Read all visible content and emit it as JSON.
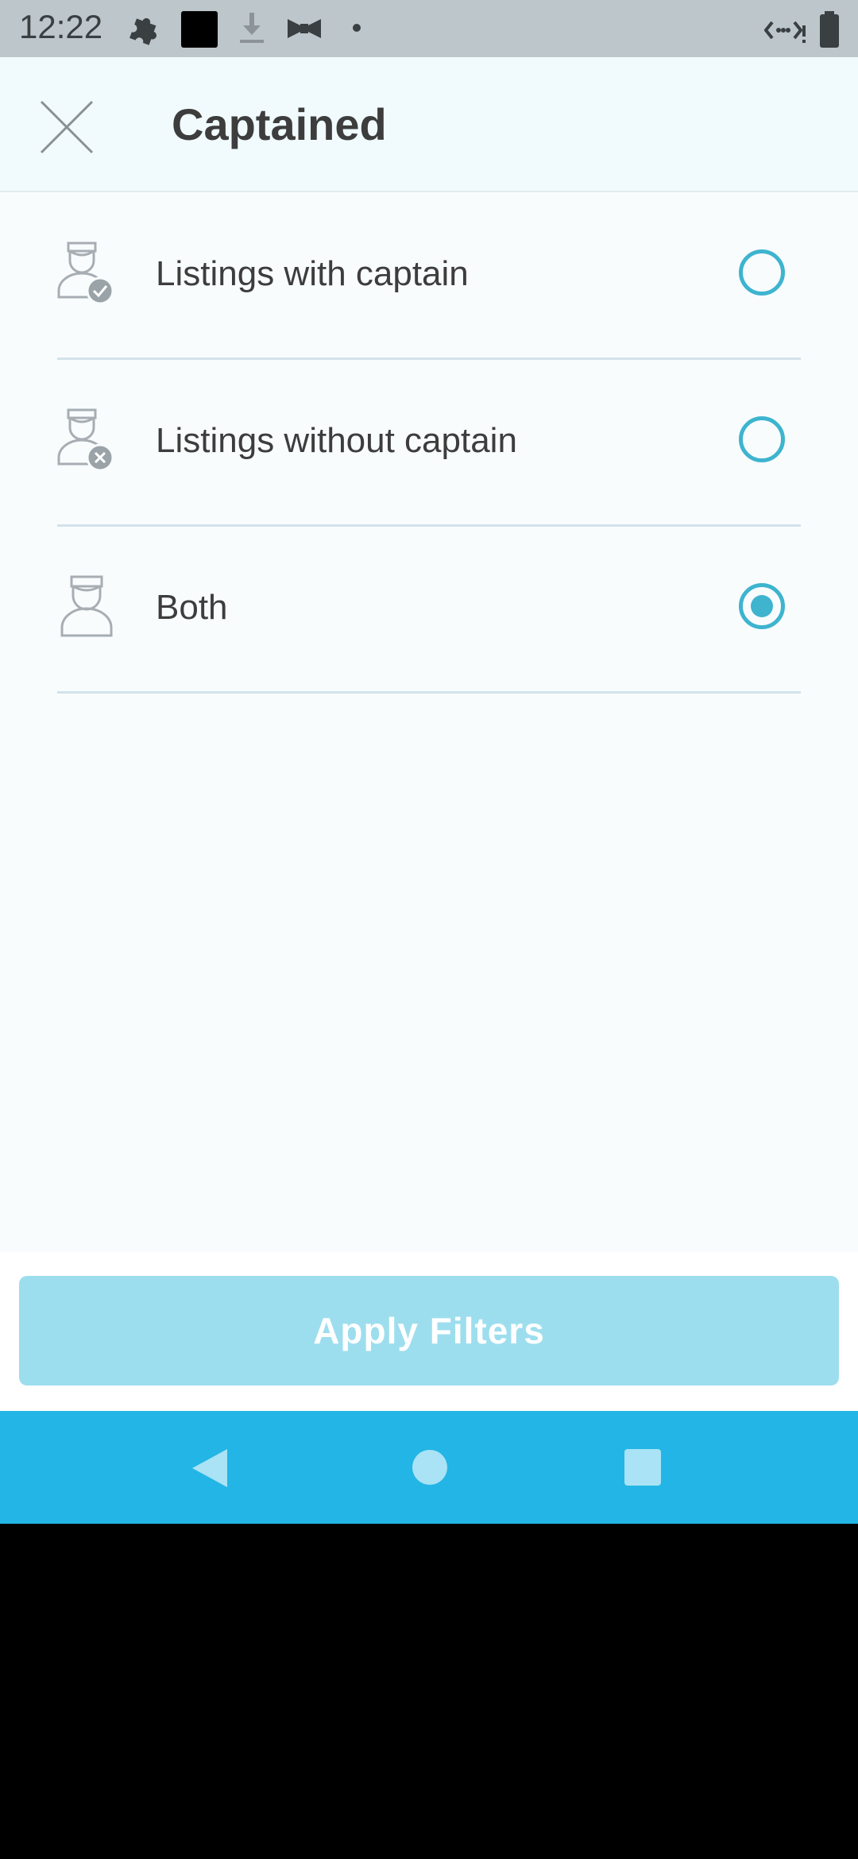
{
  "status_bar": {
    "time": "12:22",
    "icons": [
      "puzzle-icon",
      "black-square-icon",
      "download-icon",
      "bowtie-icon",
      "dot-icon",
      "signal-icon",
      "battery-icon"
    ]
  },
  "header": {
    "title": "Captained",
    "close_icon": "close-icon"
  },
  "options": [
    {
      "label": "Listings with captain",
      "icon": "captain-check-icon",
      "selected": false
    },
    {
      "label": "Listings without captain",
      "icon": "captain-x-icon",
      "selected": false
    },
    {
      "label": "Both",
      "icon": "captain-icon",
      "selected": true
    }
  ],
  "apply_button": {
    "label": "Apply Filters"
  },
  "nav_bar": {
    "buttons": [
      "back-icon",
      "home-icon",
      "recents-icon"
    ]
  },
  "colors": {
    "accent": "#3eb4cf",
    "apply_button_bg": "#9ddeee",
    "nav_bar_bg": "#23b5e5",
    "status_bar_bg": "#bcc6cb"
  }
}
